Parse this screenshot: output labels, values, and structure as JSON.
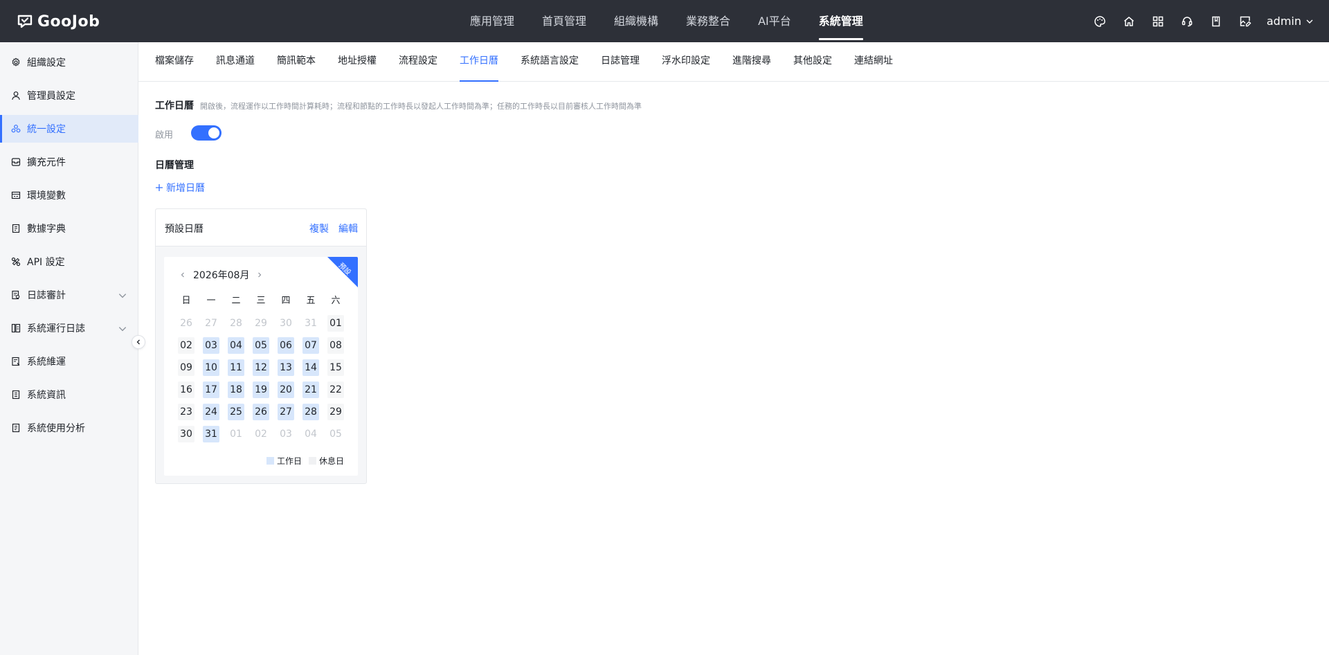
{
  "app": {
    "logo_text": "GooJob"
  },
  "topnav": {
    "items": [
      {
        "label": "應用管理"
      },
      {
        "label": "首頁管理"
      },
      {
        "label": "組織機構"
      },
      {
        "label": "業務整合"
      },
      {
        "label": "AI平台"
      },
      {
        "label": "系統管理",
        "active": true
      }
    ]
  },
  "toolbar": {
    "icons": [
      "palette-icon",
      "home-icon",
      "grid-icon",
      "support-icon",
      "book-icon",
      "edit-image-icon"
    ],
    "user": "admin"
  },
  "sidebar": {
    "items": [
      {
        "label": "組織設定",
        "icon": "gear-icon"
      },
      {
        "label": "管理員設定",
        "icon": "user-icon"
      },
      {
        "label": "統一設定",
        "icon": "cloud-icon",
        "active": true
      },
      {
        "label": "擴充元件",
        "icon": "box-icon"
      },
      {
        "label": "環境變數",
        "icon": "window-icon"
      },
      {
        "label": "數據字典",
        "icon": "dictionary-icon"
      },
      {
        "label": "API 設定",
        "icon": "api-icon"
      },
      {
        "label": "日誌審計",
        "icon": "audit-icon",
        "expandable": true
      },
      {
        "label": "系統運行日誌",
        "icon": "log-icon",
        "expandable": true
      },
      {
        "label": "系統維運",
        "icon": "maintenance-icon"
      },
      {
        "label": "系統資訊",
        "icon": "info-icon"
      },
      {
        "label": "系統使用分析",
        "icon": "analytics-icon"
      }
    ]
  },
  "subtabs": {
    "items": [
      {
        "label": "檔案儲存"
      },
      {
        "label": "訊息通道"
      },
      {
        "label": "簡訊範本"
      },
      {
        "label": "地址授權"
      },
      {
        "label": "流程設定"
      },
      {
        "label": "工作日曆",
        "active": true
      },
      {
        "label": "系統語言設定"
      },
      {
        "label": "日誌管理"
      },
      {
        "label": "浮水印設定"
      },
      {
        "label": "進階搜尋"
      },
      {
        "label": "其他設定"
      },
      {
        "label": "連結網址"
      }
    ]
  },
  "work_calendar": {
    "title": "工作日曆",
    "description": "開啟後，流程運作以工作時間計算耗時；流程和節點的工作時長以發起人工作時間為準；任務的工作時長以目前審核人工作時間為準",
    "enable_label": "啟用",
    "enabled": true
  },
  "calendar_management": {
    "title": "日曆管理",
    "add_label": "新增日曆"
  },
  "calendar_card": {
    "title": "預設日曆",
    "copy_label": "複製",
    "edit_label": "編輯",
    "ribbon": "預設",
    "month_label": "2026年08月",
    "weekdays": [
      "日",
      "一",
      "二",
      "三",
      "四",
      "五",
      "六"
    ],
    "days": [
      {
        "d": "26",
        "t": "other"
      },
      {
        "d": "27",
        "t": "other"
      },
      {
        "d": "28",
        "t": "other"
      },
      {
        "d": "29",
        "t": "other"
      },
      {
        "d": "30",
        "t": "other"
      },
      {
        "d": "31",
        "t": "other"
      },
      {
        "d": "01",
        "t": "rest"
      },
      {
        "d": "02",
        "t": "rest"
      },
      {
        "d": "03",
        "t": "work"
      },
      {
        "d": "04",
        "t": "work"
      },
      {
        "d": "05",
        "t": "work"
      },
      {
        "d": "06",
        "t": "work"
      },
      {
        "d": "07",
        "t": "work"
      },
      {
        "d": "08",
        "t": "rest"
      },
      {
        "d": "09",
        "t": "rest"
      },
      {
        "d": "10",
        "t": "work"
      },
      {
        "d": "11",
        "t": "work"
      },
      {
        "d": "12",
        "t": "work"
      },
      {
        "d": "13",
        "t": "work"
      },
      {
        "d": "14",
        "t": "work"
      },
      {
        "d": "15",
        "t": "rest"
      },
      {
        "d": "16",
        "t": "rest"
      },
      {
        "d": "17",
        "t": "work"
      },
      {
        "d": "18",
        "t": "work"
      },
      {
        "d": "19",
        "t": "work"
      },
      {
        "d": "20",
        "t": "work"
      },
      {
        "d": "21",
        "t": "work"
      },
      {
        "d": "22",
        "t": "rest"
      },
      {
        "d": "23",
        "t": "rest"
      },
      {
        "d": "24",
        "t": "work"
      },
      {
        "d": "25",
        "t": "work"
      },
      {
        "d": "26",
        "t": "work"
      },
      {
        "d": "27",
        "t": "work"
      },
      {
        "d": "28",
        "t": "work"
      },
      {
        "d": "29",
        "t": "rest"
      },
      {
        "d": "30",
        "t": "rest"
      },
      {
        "d": "31",
        "t": "work"
      },
      {
        "d": "01",
        "t": "other"
      },
      {
        "d": "02",
        "t": "other"
      },
      {
        "d": "03",
        "t": "other"
      },
      {
        "d": "04",
        "t": "other"
      },
      {
        "d": "05",
        "t": "other"
      }
    ],
    "legend": {
      "workday": "工作日",
      "restday": "休息日"
    }
  },
  "colors": {
    "accent": "#3370ff",
    "topbar": "#2d3038",
    "workday": "#d7e6fb",
    "restday": "#f5f6f7"
  }
}
